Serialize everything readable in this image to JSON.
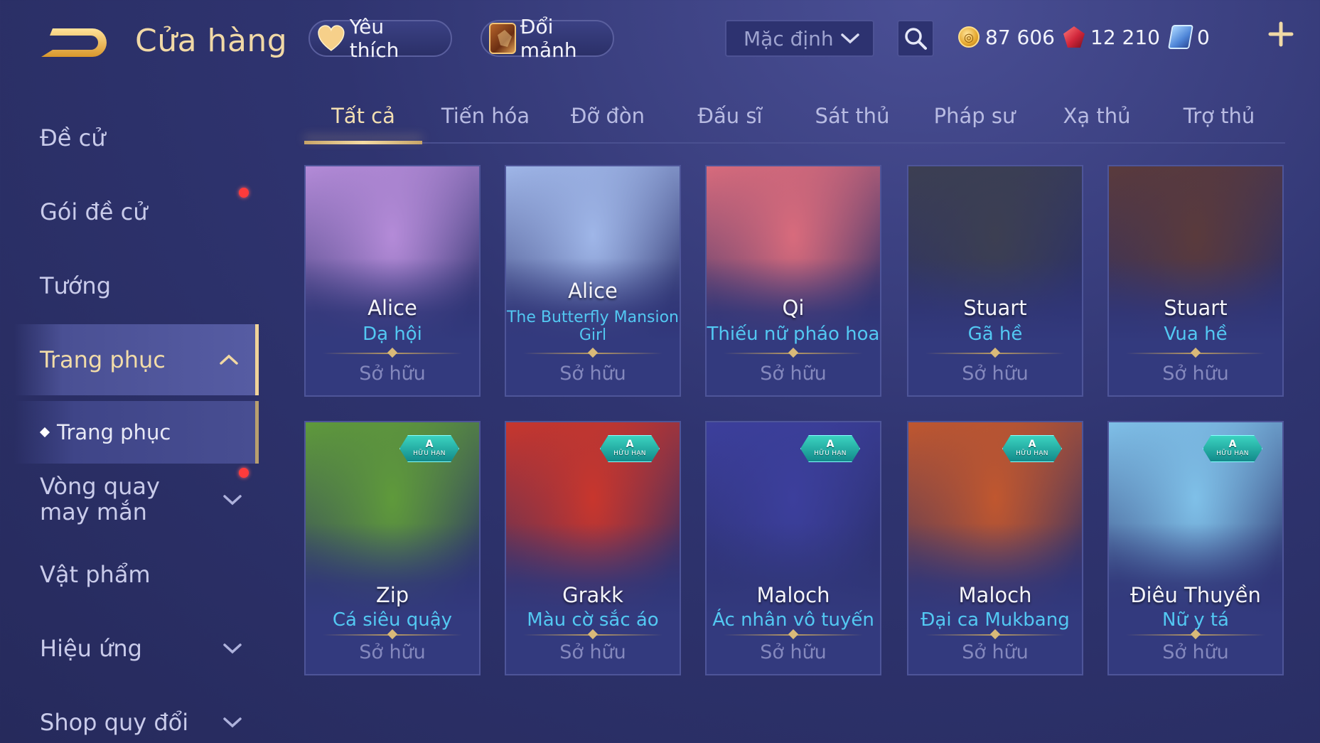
{
  "header": {
    "title": "Cửa hàng",
    "favorite_label": "Yêu thích",
    "exchange_label": "Đổi mảnh",
    "sort_value": "Mặc định",
    "currencies": {
      "gold": "87 606",
      "ruby": "12 210",
      "voucher": "0"
    }
  },
  "sidebar": {
    "items": [
      {
        "label": "Đề cử"
      },
      {
        "label": "Gói đề cử"
      },
      {
        "label": "Tướng"
      },
      {
        "label": "Trang phục"
      },
      {
        "label": "Vòng quay may mắn"
      },
      {
        "label": "Vật phẩm"
      },
      {
        "label": "Hiệu ứng"
      },
      {
        "label": "Shop quy đổi"
      }
    ],
    "sub_item": "Trang phục"
  },
  "tabs": [
    "Tất cả",
    "Tiến hóa",
    "Đỡ đòn",
    "Đấu sĩ",
    "Sát thủ",
    "Pháp sư",
    "Xạ thủ",
    "Trợ thủ"
  ],
  "cards": [
    {
      "hero": "Alice",
      "skin": "Dạ hội",
      "status": "Sở hữu",
      "limited": false,
      "art": "#b48bd8"
    },
    {
      "hero": "Alice",
      "skin": "The Butterfly Mansion Girl",
      "status": "Sở hữu",
      "limited": false,
      "art": "#9fb6e8"
    },
    {
      "hero": "Qi",
      "skin": "Thiếu nữ pháo hoa",
      "status": "Sở hữu",
      "limited": false,
      "art": "#d86b7c"
    },
    {
      "hero": "Stuart",
      "skin": "Gã hề",
      "status": "Sở hữu",
      "limited": false,
      "art": "#3c3f52"
    },
    {
      "hero": "Stuart",
      "skin": "Vua hề",
      "status": "Sở hữu",
      "limited": false,
      "art": "#5a3a3c"
    },
    {
      "hero": "Zip",
      "skin": "Cá siêu quậy",
      "status": "Sở hữu",
      "limited": true,
      "art": "#5f9a3b"
    },
    {
      "hero": "Grakk",
      "skin": "Màu cờ sắc áo",
      "status": "Sở hữu",
      "limited": true,
      "art": "#c8362d"
    },
    {
      "hero": "Maloch",
      "skin": "Ác nhân vô tuyến",
      "status": "Sở hữu",
      "limited": true,
      "art": "#3c3f9c"
    },
    {
      "hero": "Maloch",
      "skin": "Đại ca Mukbang",
      "status": "Sở hữu",
      "limited": true,
      "art": "#c0572f"
    },
    {
      "hero": "Điêu Thuyền",
      "skin": "Nữ y tá",
      "status": "Sở hữu",
      "limited": true,
      "art": "#7fc0e8"
    }
  ],
  "badge": {
    "grade": "A",
    "label": "HỮU HẠN"
  }
}
